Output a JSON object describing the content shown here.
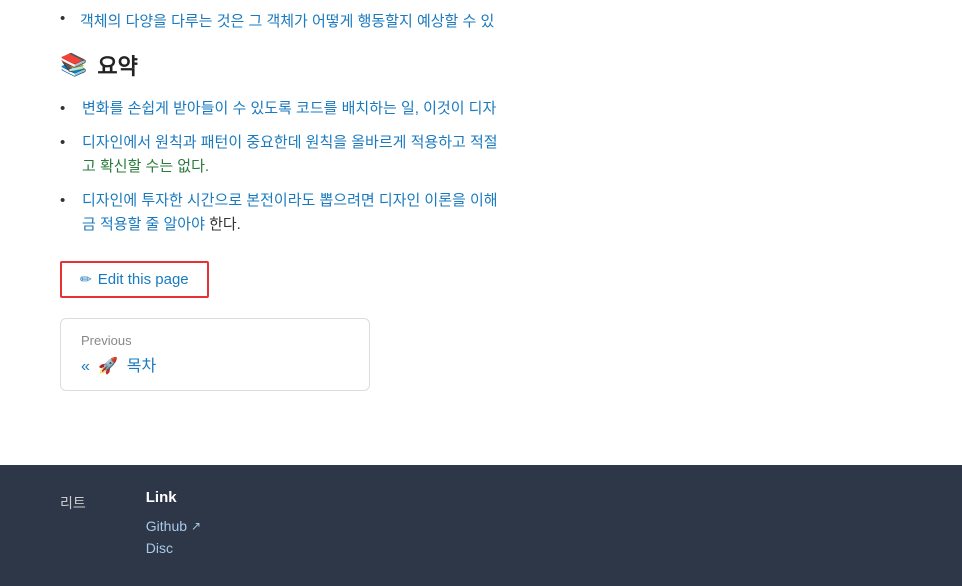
{
  "top_bullet": {
    "text_before": "객체의 다양을 다루는 것은 그 객체가 어떻게 행동할지 예상할 수 있",
    "link_color": "#1a7abf"
  },
  "summary": {
    "icon": "📚",
    "title": "요약",
    "bullets": [
      {
        "parts": [
          {
            "type": "link",
            "text": "변화를 손쉽게 받아들이 수 있도록 코드를 배치하는 일, 이것이 디자"
          },
          {
            "type": "text",
            "text": ""
          }
        ]
      },
      {
        "parts": [
          {
            "type": "link",
            "text": "디자인에서 원칙과 패턴이 중요한데 원칙을 올바르게 적용하고 적절"
          },
          {
            "type": "text",
            "text": ""
          },
          {
            "type": "link",
            "text": "고 확신할 수는 없다."
          }
        ]
      },
      {
        "parts": [
          {
            "type": "link",
            "text": "디자인에 투자한 시간으로 본전이라도 뽑으려면 디자인 이론을 이해"
          },
          {
            "type": "text",
            "text": ""
          },
          {
            "type": "link",
            "text": "금 적용할 줄 알아야"
          },
          {
            "type": "text",
            "text": " 한다."
          }
        ]
      }
    ]
  },
  "edit_button": {
    "label": "Edit this page",
    "pencil": "✏"
  },
  "nav": {
    "previous_label": "Previous",
    "previous_arrow": "«",
    "previous_emoji": "🚀",
    "previous_title": "목차"
  },
  "footer": {
    "left_text": "리트",
    "links_heading": "Link",
    "links": [
      {
        "label": "Github",
        "icon": "↗",
        "href": "#"
      },
      {
        "label": "Disc",
        "icon": "",
        "href": "#"
      }
    ]
  }
}
